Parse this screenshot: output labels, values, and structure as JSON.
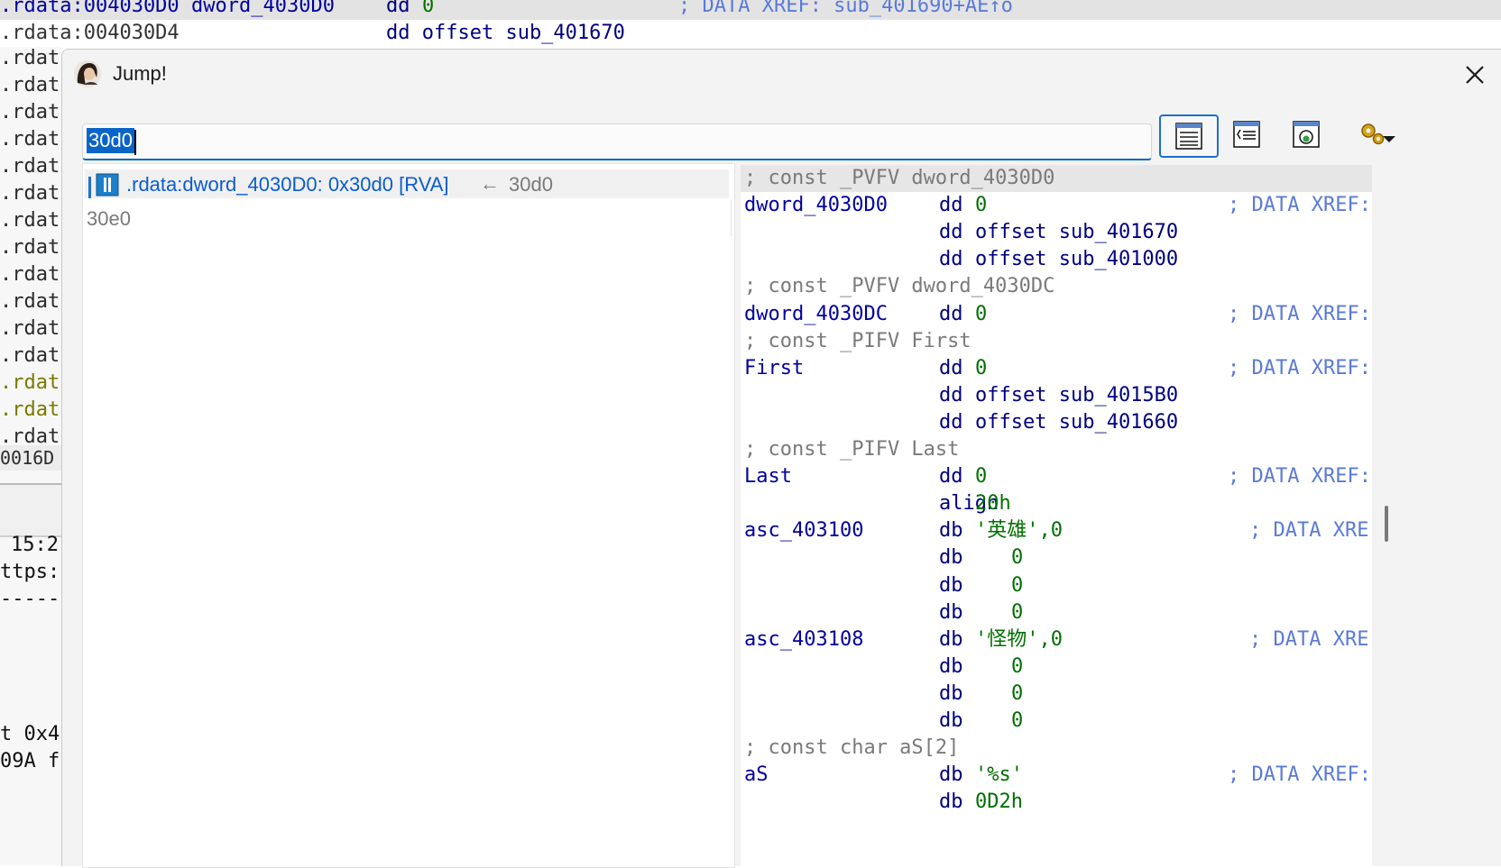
{
  "background": {
    "top_row1": {
      "address": ".rdata:004030D0",
      "label": "dword_4030D0",
      "instr": "dd",
      "operand": "0",
      "comment": "; DATA XREF: sub_401690+AE↑o"
    },
    "top_row2": {
      "address": ".rdata:004030D4",
      "instr": "dd offset sub_401670"
    },
    "left_lines": [
      ".rdat",
      ".rdat",
      ".rdat",
      ".rdat",
      ".rdat",
      ".rdat",
      ".rdat",
      ".rdat",
      ".rdat",
      ".rdat",
      ".rdat",
      ".rdat",
      ".rdat",
      ".rdat",
      ".rdat"
    ],
    "left_status": "0016D",
    "left_bottom": {
      "time": "15:2",
      "url": "ttps:",
      "dashes": "-----",
      "line1": "t 0x4",
      "line2": "09A f"
    }
  },
  "dialog": {
    "title": "Jump!",
    "title_icon": "avatar-icon",
    "close_icon": "close-icon",
    "search": {
      "value": "30d0"
    },
    "toolbar": [
      {
        "icon": "listing-view-icon",
        "active": true
      },
      {
        "icon": "pseudocode-view-icon",
        "active": false
      },
      {
        "icon": "graph-view-icon",
        "active": false
      },
      {
        "icon": "options-gear-icon",
        "active": false
      }
    ],
    "results": [
      {
        "icon": "data-segment-icon",
        "text": ".rdata:dword_4030D0: 0x30d0 [RVA]",
        "arrow": "←",
        "hint": "30d0",
        "selected": true
      },
      {
        "text": "30e0"
      }
    ]
  },
  "preview_lines": [
    {
      "comment": "; const _PVFV dword_4030D0"
    },
    {
      "label": "dword_4030D0",
      "kw": "dd",
      "operand": "0",
      "operand_type": "num",
      "xref": "; DATA XREF:"
    },
    {
      "kw": "dd",
      "operand": "offset sub_401670",
      "operand_type": "kw"
    },
    {
      "kw": "dd",
      "operand": "offset sub_401000",
      "operand_type": "kw"
    },
    {
      "comment": "; const _PVFV dword_4030DC"
    },
    {
      "label": "dword_4030DC",
      "kw": "dd",
      "operand": "0",
      "operand_type": "num",
      "xref": "; DATA XREF:"
    },
    {
      "comment": "; const _PIFV First"
    },
    {
      "label": "First",
      "kw": "dd",
      "operand": "0",
      "operand_type": "num",
      "xref": "; DATA XREF:"
    },
    {
      "kw": "dd",
      "operand": "offset sub_4015B0",
      "operand_type": "kw"
    },
    {
      "kw": "dd",
      "operand": "offset sub_401660",
      "operand_type": "kw"
    },
    {
      "comment": "; const _PIFV Last"
    },
    {
      "label": "Last",
      "kw": "dd",
      "operand": "0",
      "operand_type": "num",
      "xref": "; DATA XREF:"
    },
    {
      "kw": "align",
      "operand": "20h",
      "operand_type": "num"
    },
    {
      "label": "asc_403100",
      "kw": "db",
      "operand": "'英雄',0",
      "operand_type": "str",
      "xref": "; DATA XRE",
      "xref_shift": true
    },
    {
      "kw": "db",
      "operand": "0",
      "operand_type": "numpad"
    },
    {
      "kw": "db",
      "operand": "0",
      "operand_type": "numpad"
    },
    {
      "kw": "db",
      "operand": "0",
      "operand_type": "numpad"
    },
    {
      "label": "asc_403108",
      "kw": "db",
      "operand": "'怪物',0",
      "operand_type": "str",
      "xref": "; DATA XRE",
      "xref_shift": true
    },
    {
      "kw": "db",
      "operand": "0",
      "operand_type": "numpad"
    },
    {
      "kw": "db",
      "operand": "0",
      "operand_type": "numpad"
    },
    {
      "kw": "db",
      "operand": "0",
      "operand_type": "numpad"
    },
    {
      "comment": "; const char aS[2]"
    },
    {
      "label": "aS",
      "kw": "db",
      "operand": "'%s'",
      "operand_type": "str",
      "xref": "; DATA XREF:"
    },
    {
      "kw": "db",
      "operand": "0D2h",
      "operand_type": "num"
    }
  ],
  "colors": {
    "accent": "#0067c0",
    "selection": "#0a64c8",
    "link": "#0a5cd1",
    "code_label": "#0000a0",
    "code_number": "#007000",
    "xref": "#5a7ad8"
  }
}
